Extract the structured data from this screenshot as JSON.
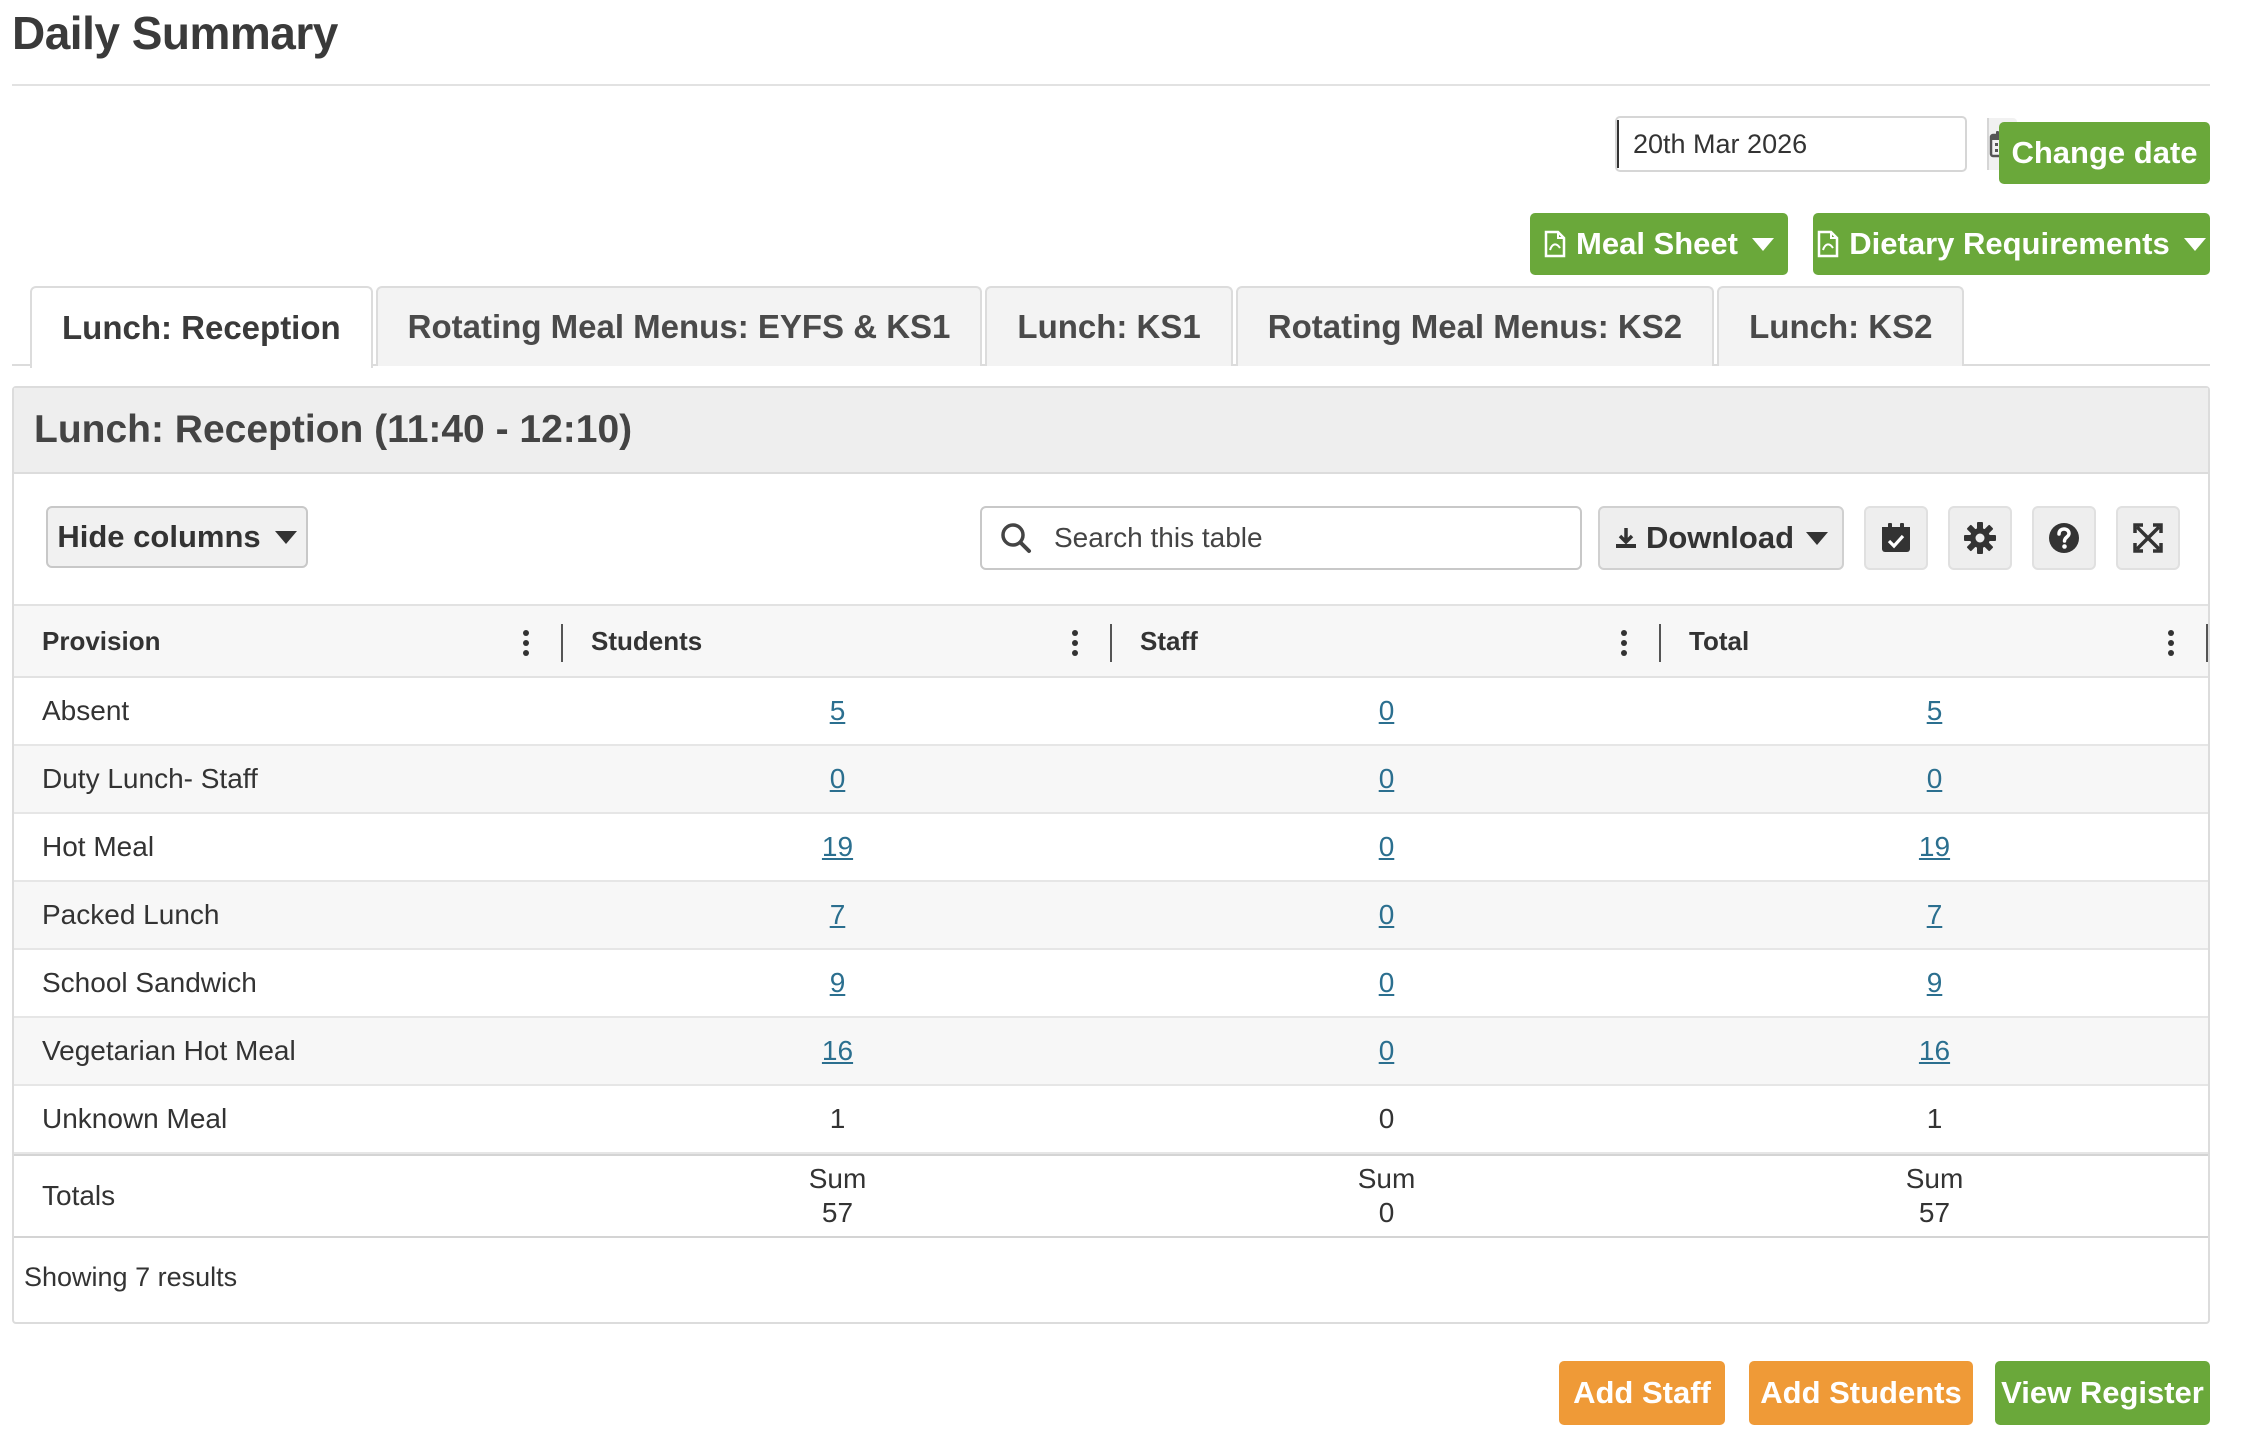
{
  "page": {
    "title": "Daily Summary"
  },
  "date_picker": {
    "value": "20th Mar 2026",
    "button_label": "Change date"
  },
  "actions": {
    "meal_sheet": "Meal Sheet",
    "dietary": "Dietary Requirements"
  },
  "tabs": [
    {
      "label": "Lunch: Reception",
      "active": true
    },
    {
      "label": "Rotating Meal Menus: EYFS & KS1",
      "active": false
    },
    {
      "label": "Lunch: KS1",
      "active": false
    },
    {
      "label": "Rotating Meal Menus: KS2",
      "active": false
    },
    {
      "label": "Lunch: KS2",
      "active": false
    }
  ],
  "panel": {
    "title": "Lunch: Reception (11:40 - 12:10)"
  },
  "toolbar": {
    "hide_columns": "Hide columns",
    "search_placeholder": "Search this table",
    "download": "Download"
  },
  "table": {
    "columns": [
      "Provision",
      "Students",
      "Staff",
      "Total"
    ],
    "rows": [
      {
        "provision": "Absent",
        "students": "5",
        "staff": "0",
        "total": "5",
        "linked": true
      },
      {
        "provision": "Duty Lunch- Staff",
        "students": "0",
        "staff": "0",
        "total": "0",
        "linked": true
      },
      {
        "provision": "Hot Meal",
        "students": "19",
        "staff": "0",
        "total": "19",
        "linked": true
      },
      {
        "provision": "Packed Lunch",
        "students": "7",
        "staff": "0",
        "total": "7",
        "linked": true
      },
      {
        "provision": "School Sandwich",
        "students": "9",
        "staff": "0",
        "total": "9",
        "linked": true
      },
      {
        "provision": "Vegetarian Hot Meal",
        "students": "16",
        "staff": "0",
        "total": "16",
        "linked": true
      },
      {
        "provision": "Unknown Meal",
        "students": "1",
        "staff": "0",
        "total": "1",
        "linked": false
      }
    ],
    "totals": {
      "label": "Totals",
      "sum_label": "Sum",
      "students": "57",
      "staff": "0",
      "total": "57"
    },
    "result_count": "Showing 7 results"
  },
  "footer": {
    "add_staff": "Add Staff",
    "add_students": "Add Students",
    "view_register": "View Register"
  },
  "colors": {
    "green": "#6aa83a",
    "orange": "#ef9a37",
    "link": "#2b6f8f"
  }
}
